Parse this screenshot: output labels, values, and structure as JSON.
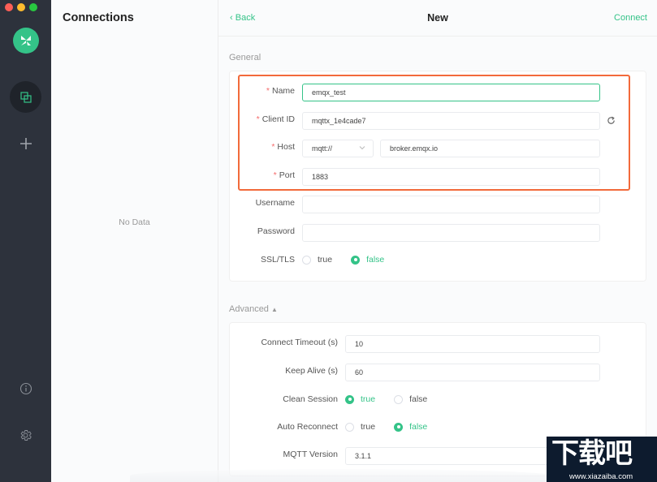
{
  "window": {
    "controls": [
      "close",
      "minimize",
      "maximize"
    ]
  },
  "nav": {
    "logo": "mqttx-logo",
    "items": [
      {
        "name": "connections",
        "icon": "connections-icon",
        "active": true
      },
      {
        "name": "new-connection",
        "icon": "plus-icon",
        "active": false
      },
      {
        "name": "about",
        "icon": "info-icon",
        "active": false
      },
      {
        "name": "settings",
        "icon": "gear-icon",
        "active": false
      }
    ]
  },
  "connections": {
    "title": "Connections",
    "empty_text": "No Data"
  },
  "header": {
    "back_label": "Back",
    "back_icon": "chevron-left-icon",
    "title": "New",
    "connect_label": "Connect"
  },
  "general": {
    "section_label": "General",
    "name": {
      "label": "Name",
      "required": "*",
      "value": "emqx_test"
    },
    "client_id": {
      "label": "Client ID",
      "required": "*",
      "value": "mqttx_1e4cade7",
      "refresh_icon": "refresh-icon"
    },
    "host": {
      "label": "Host",
      "required": "*",
      "protocol": "mqtt://",
      "value": "broker.emqx.io"
    },
    "port": {
      "label": "Port",
      "required": "*",
      "value": "1883"
    },
    "username": {
      "label": "Username",
      "value": ""
    },
    "password": {
      "label": "Password",
      "value": ""
    },
    "ssl": {
      "label": "SSL/TLS",
      "options": [
        "true",
        "false"
      ],
      "selected": "false"
    }
  },
  "advanced": {
    "section_label": "Advanced",
    "toggle_icon": "caret-up-icon",
    "connect_timeout": {
      "label": "Connect Timeout (s)",
      "value": "10"
    },
    "keep_alive": {
      "label": "Keep Alive (s)",
      "value": "60"
    },
    "clean_session": {
      "label": "Clean Session",
      "options": [
        "true",
        "false"
      ],
      "selected": "true"
    },
    "auto_reconnect": {
      "label": "Auto Reconnect",
      "options": [
        "true",
        "false"
      ],
      "selected": "false"
    },
    "mqtt_version": {
      "label": "MQTT Version",
      "value": "3.1.1"
    }
  },
  "watermark": {
    "title": "下载吧",
    "url": "www.xiazaiba.com"
  },
  "colors": {
    "accent": "#34c388",
    "highlight": "#f26a3b",
    "required": "#f56c6c",
    "nav_bg": "#2d323c"
  }
}
